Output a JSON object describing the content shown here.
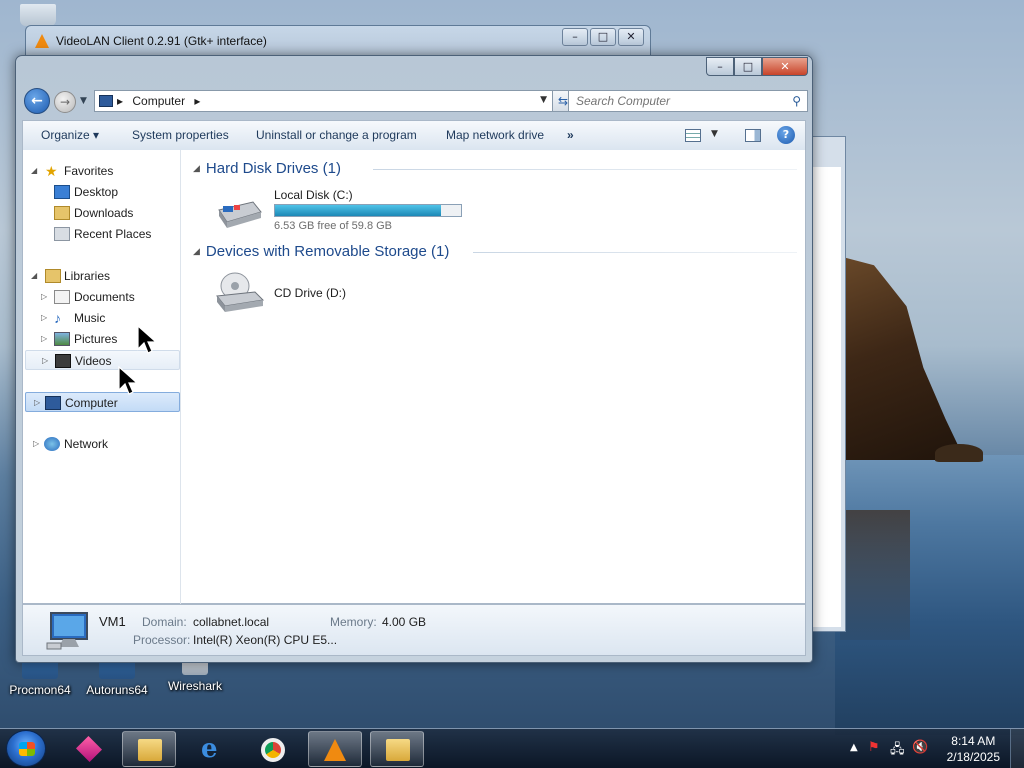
{
  "desktop": {
    "icons": [
      {
        "label": "Procmon64"
      },
      {
        "label": "Autoruns64"
      },
      {
        "label": "Wireshark"
      }
    ]
  },
  "vlc_window": {
    "title": "VideoLAN Client 0.2.91 (Gtk+ interface)"
  },
  "window_controls": {
    "minimize": "–",
    "maximize": "□",
    "close": "✕"
  },
  "explorer": {
    "address": {
      "crumb": "Computer",
      "separator": "▸"
    },
    "search": {
      "placeholder": "Search Computer"
    },
    "toolbar": {
      "organize": "Organize ▾",
      "system_properties": "System properties",
      "uninstall": "Uninstall or change a program",
      "map_drive": "Map network drive",
      "more": "»"
    },
    "nav_pane": {
      "favorites": "Favorites",
      "desktop": "Desktop",
      "downloads": "Downloads",
      "recent_places": "Recent Places",
      "libraries": "Libraries",
      "documents": "Documents",
      "music": "Music",
      "pictures": "Pictures",
      "videos": "Videos",
      "computer": "Computer",
      "network": "Network"
    },
    "groups": {
      "hdd": {
        "header": "Hard Disk Drives (1)",
        "drive_name": "Local Disk (C:)",
        "free_text": "6.53 GB free of 59.8 GB",
        "used_fraction": 0.89
      },
      "removable": {
        "header": "Devices with Removable Storage (1)",
        "drive_name": "CD Drive (D:)"
      }
    },
    "details": {
      "name": "VM1",
      "domain_label": "Domain:",
      "domain_value": "collabnet.local",
      "memory_label": "Memory:",
      "memory_value": "4.00 GB",
      "processor_label": "Processor:",
      "processor_value": "Intel(R) Xeon(R) CPU E5..."
    }
  },
  "taskbar": {
    "clock_time": "8:14 AM",
    "clock_date": "2/18/2025"
  },
  "colors": {
    "accent": "#1e4a8c",
    "progress": "#1c88b6",
    "taskbar": "#0a1423"
  }
}
